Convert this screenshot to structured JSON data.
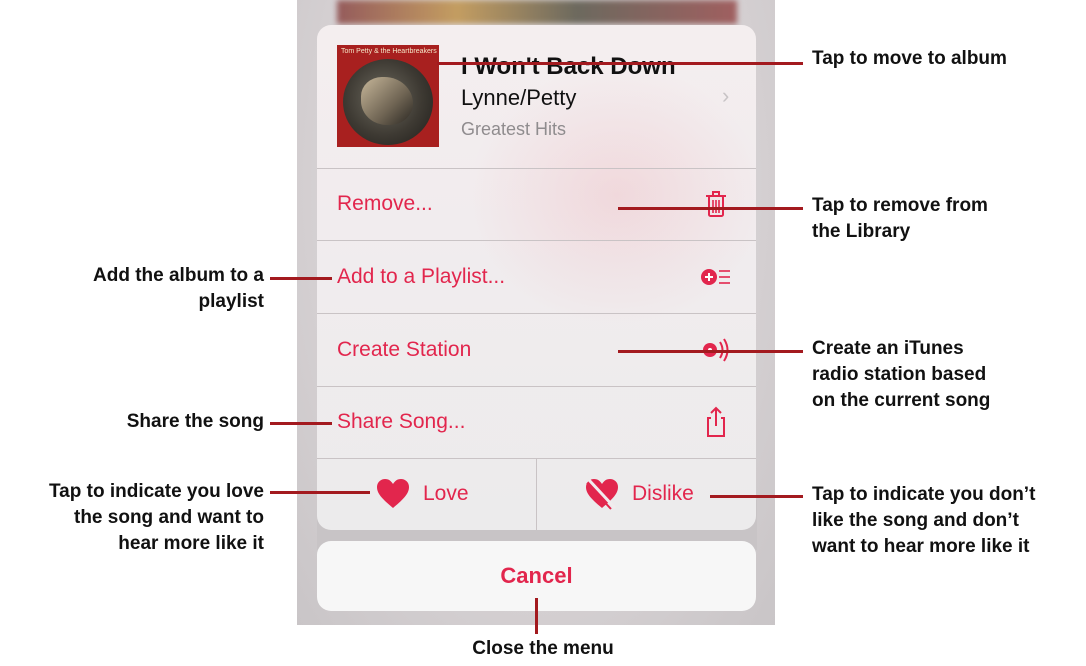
{
  "song": {
    "title": "I Won't Back Down",
    "artist": "Lynne/Petty",
    "album": "Greatest Hits",
    "album_art_band_text": "Tom Petty & the Heartbreakers"
  },
  "menu": {
    "remove_label": "Remove...",
    "add_playlist_label": "Add to a Playlist...",
    "create_station_label": "Create Station",
    "share_label": "Share Song...",
    "love_label": "Love",
    "dislike_label": "Dislike",
    "cancel_label": "Cancel"
  },
  "callouts": {
    "move_album": "Tap to move to album",
    "remove_line1": "Tap to remove from",
    "remove_line2": "the Library",
    "add_line1": "Add the album to a",
    "add_line2": "playlist",
    "station_line1": "Create an iTunes",
    "station_line2": "radio station based",
    "station_line3": "on the current song",
    "share": "Share the song",
    "love_line1": "Tap to indicate you love",
    "love_line2": "the song and want to",
    "love_line3": "hear more like it",
    "dislike_line1": "Tap to indicate you don’t",
    "dislike_line2": "like the song and don’t",
    "dislike_line3": "want to hear more like it",
    "close": "Close the menu"
  },
  "colors": {
    "accent": "#e2264d",
    "callout_line": "#a31a1f"
  },
  "icons": [
    "trash-icon",
    "add-playlist-icon",
    "radio-station-icon",
    "share-icon",
    "heart-icon",
    "dislike-heart-icon",
    "chevron-right-icon"
  ]
}
